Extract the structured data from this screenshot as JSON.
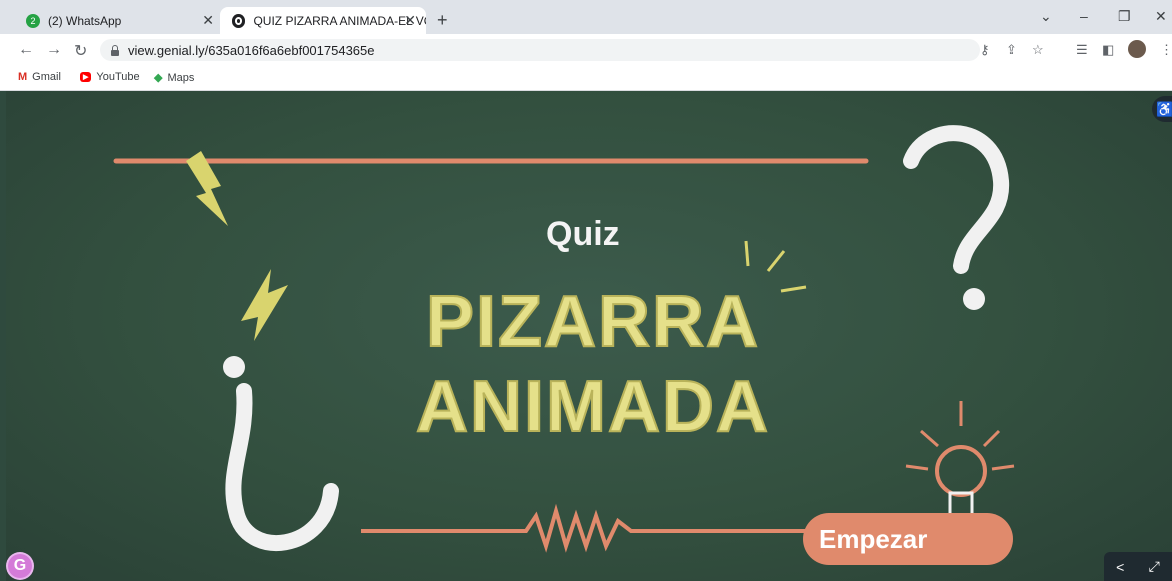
{
  "tabs": [
    {
      "title": "(2) WhatsApp",
      "badge": "2",
      "icon": "whatsapp-icon"
    },
    {
      "title": "QUIZ PIZARRA ANIMADA-EL VO",
      "icon": "genially-icon"
    }
  ],
  "window_controls": {
    "minimize": "–",
    "restore": "❐",
    "close": "✕",
    "overflow": "⌄"
  },
  "address_bar": {
    "url": "view.genial.ly/635a016f6a6ebf001754365e"
  },
  "bookmarks": [
    {
      "label": "Gmail",
      "icon": "gmail-icon"
    },
    {
      "label": "YouTube",
      "icon": "youtube-icon"
    },
    {
      "label": "Maps",
      "icon": "maps-icon"
    }
  ],
  "slide": {
    "quiz_label": "Quiz",
    "title_line1": "PIZARRA",
    "title_line2": "ANIMADA",
    "start_button": "Empezar"
  },
  "colors": {
    "board": "#33503f",
    "chalk_yellow": "#e5e08a",
    "accent_orange": "#e08a6c",
    "chalk_white": "#f4f4f4"
  }
}
